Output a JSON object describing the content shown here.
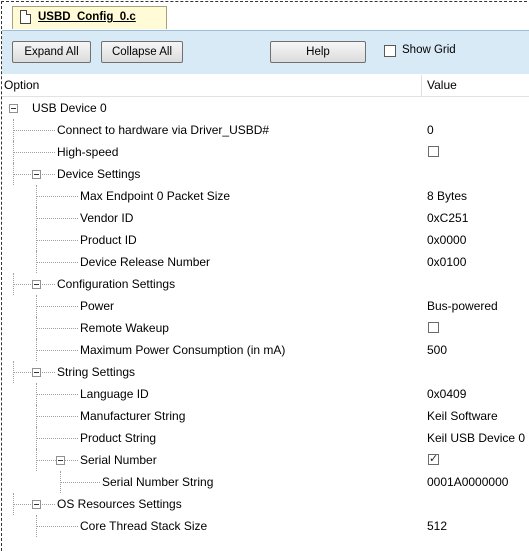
{
  "tab": {
    "label": "USBD_Config_0.c",
    "icon": "document-icon"
  },
  "toolbar": {
    "expand_all": "Expand All",
    "collapse_all": "Collapse All",
    "help": "Help",
    "show_grid": "Show Grid",
    "show_grid_checked": false
  },
  "columns": {
    "option": "Option",
    "value": "Value"
  },
  "tree": [
    {
      "label": "USB Device 0",
      "level": 0,
      "expander": true
    },
    {
      "label": "Connect to hardware via Driver_USBD#",
      "level": 1,
      "value": "0"
    },
    {
      "label": "High-speed",
      "level": 1,
      "checkbox": false
    },
    {
      "label": "Device Settings",
      "level": 1,
      "expander": true
    },
    {
      "label": "Max Endpoint 0 Packet Size",
      "level": 2,
      "value": "8 Bytes"
    },
    {
      "label": "Vendor ID",
      "level": 2,
      "value": "0xC251"
    },
    {
      "label": "Product ID",
      "level": 2,
      "value": "0x0000"
    },
    {
      "label": "Device Release Number",
      "level": 2,
      "value": "0x0100"
    },
    {
      "label": "Configuration Settings",
      "level": 1,
      "expander": true
    },
    {
      "label": "Power",
      "level": 2,
      "value": "Bus-powered"
    },
    {
      "label": "Remote Wakeup",
      "level": 2,
      "checkbox": false
    },
    {
      "label": "Maximum Power Consumption (in mA)",
      "level": 2,
      "value": "500"
    },
    {
      "label": "String Settings",
      "level": 1,
      "expander": true
    },
    {
      "label": "Language ID",
      "level": 2,
      "value": "0x0409"
    },
    {
      "label": "Manufacturer String",
      "level": 2,
      "value": "Keil Software"
    },
    {
      "label": "Product String",
      "level": 2,
      "value": "Keil USB Device 0"
    },
    {
      "label": "Serial Number",
      "level": 2,
      "expander": true,
      "checkbox": true
    },
    {
      "label": "Serial Number String",
      "level": 3,
      "value": "0001A0000000"
    },
    {
      "label": "OS Resources Settings",
      "level": 1,
      "expander": true
    },
    {
      "label": "Core Thread Stack Size",
      "level": 2,
      "value": "512"
    }
  ]
}
